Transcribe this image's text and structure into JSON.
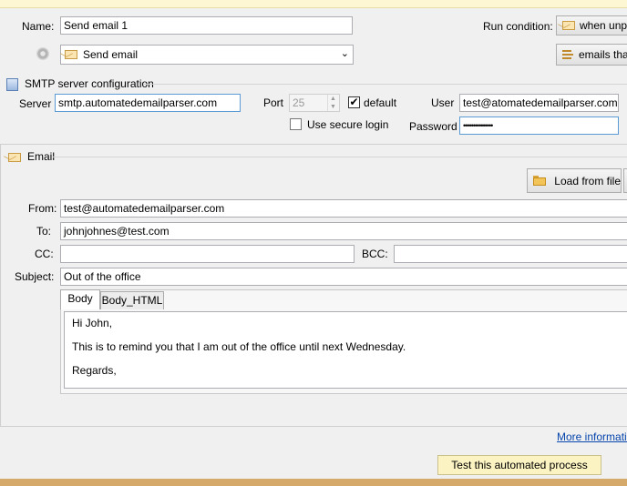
{
  "general": {
    "name_label": "Name:",
    "name_value": "Send email 1",
    "action_select": "Send email",
    "run_condition_label": "Run condition:",
    "run_condition_value": "when unpro",
    "emails_that_button": "emails that"
  },
  "smtp": {
    "section_title": "SMTP server configuration",
    "server_label": "Server",
    "server_value": "smtp.automatedemailparser.com",
    "port_label": "Port",
    "port_value": "25",
    "default_label": "default",
    "default_checked": true,
    "secure_login_label": "Use secure login",
    "secure_login_checked": false,
    "user_label": "User",
    "user_value": "test@atomatedemailparser.com",
    "password_label": "Password",
    "password_value": "•••••••••••••••"
  },
  "email": {
    "section_title": "Email",
    "load_from_file_label": "Load from file",
    "from_label": "From:",
    "from_value": "test@automatedemailparser.com",
    "to_label": "To:",
    "to_value": "johnjohnes@test.com",
    "cc_label": "CC:",
    "cc_value": "",
    "bcc_label": "BCC:",
    "bcc_value": "",
    "subject_label": "Subject:",
    "subject_value": "Out of the office",
    "tabs": [
      {
        "label": "Body",
        "active": true
      },
      {
        "label": "Body_HTML",
        "active": false
      }
    ],
    "body_lines": [
      "Hi John,",
      "This is to remind you that I am out of the office until next Wednesday.",
      "Regards,"
    ]
  },
  "footer": {
    "more_info_link": "More information",
    "test_button": "Test this automated process"
  },
  "icons": {
    "envelope": "envelope-icon",
    "gear": "gear-icon",
    "server": "server-icon",
    "folder": "folder-open-icon",
    "dropdown": "chevron-down-icon"
  }
}
